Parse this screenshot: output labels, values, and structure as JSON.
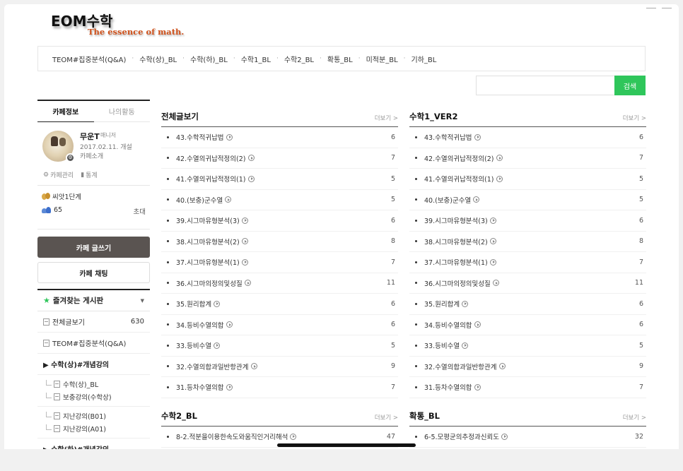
{
  "logo": {
    "main": "EOM수학",
    "tagline": "The essence of math."
  },
  "topnav": [
    "TEOM#집중분석(Q&A)",
    "수학(상)_BL",
    "수학(하)_BL",
    "수학1_BL",
    "수학2_BL",
    "확통_BL",
    "미적분_BL",
    "기하_BL"
  ],
  "search": {
    "button": "검색",
    "placeholder": ""
  },
  "sidebar": {
    "tabs": [
      "카페정보",
      "나의활동"
    ],
    "profile": {
      "name": "무운T",
      "role": "매니저",
      "date": "2017.02.11. 개설",
      "intro": "카페소개",
      "manage": "카페관리",
      "stats": "통계"
    },
    "level": "씨앗1단계",
    "members": "65",
    "invite": "초대",
    "write_button": "카페 글쓰기",
    "chat_button": "카페 채팅",
    "favorites": "즐겨찾는 게시판",
    "menu": {
      "all": "전체글보기",
      "all_count": "630",
      "teom": "TEOM#집중분석(Q&A)",
      "group1": "▶ 수학(상)#개념강의",
      "sub1": [
        "수학(상)_BL",
        "보충강의(수학상)"
      ],
      "sub2": [
        "지난강의(B01)",
        "지난강의(A01)"
      ],
      "group2": "▶ 수학(하)#개념강의"
    }
  },
  "more_label": "더보기 >",
  "boards": [
    {
      "title": "전체글보기",
      "posts": [
        {
          "t": "43.수학적귀납법",
          "c": "6"
        },
        {
          "t": "42.수열의귀납적정의(2)",
          "c": "7"
        },
        {
          "t": "41.수열의귀납적정의(1)",
          "c": "5"
        },
        {
          "t": "40.(보충)군수열",
          "c": "5"
        },
        {
          "t": "39.시그마유형분석(3)",
          "c": "6"
        },
        {
          "t": "38.시그마유형분석(2)",
          "c": "8"
        },
        {
          "t": "37.시그마유형분석(1)",
          "c": "7"
        },
        {
          "t": "36.시그마의정의및성질",
          "c": "11"
        },
        {
          "t": "35.원리합계",
          "c": "6"
        },
        {
          "t": "34.등비수열의합",
          "c": "6"
        },
        {
          "t": "33.등비수열",
          "c": "5"
        },
        {
          "t": "32.수열의합과일반항관계",
          "c": "9"
        },
        {
          "t": "31.등차수열의합",
          "c": "7"
        }
      ]
    },
    {
      "title": "수학1_VER2",
      "posts": [
        {
          "t": "43.수학적귀납법",
          "c": "6"
        },
        {
          "t": "42.수열의귀납적정의(2)",
          "c": "7"
        },
        {
          "t": "41.수열의귀납적정의(1)",
          "c": "5"
        },
        {
          "t": "40.(보충)군수열",
          "c": "5"
        },
        {
          "t": "39.시그마유형분석(3)",
          "c": "6"
        },
        {
          "t": "38.시그마유형분석(2)",
          "c": "8"
        },
        {
          "t": "37.시그마유형분석(1)",
          "c": "7"
        },
        {
          "t": "36.시그마의정의및성질",
          "c": "11"
        },
        {
          "t": "35.원리합계",
          "c": "6"
        },
        {
          "t": "34.등비수열의합",
          "c": "6"
        },
        {
          "t": "33.등비수열",
          "c": "5"
        },
        {
          "t": "32.수열의합과일반항관계",
          "c": "9"
        },
        {
          "t": "31.등차수열의합",
          "c": "7"
        }
      ]
    },
    {
      "title": "수학2_BL",
      "posts": [
        {
          "t": "8-2.적분을이용한속도와움직인거리해석",
          "c": "47"
        }
      ]
    },
    {
      "title": "확통_BL",
      "posts": [
        {
          "t": "6-5.모평균의추정과신뢰도",
          "c": "32"
        }
      ]
    }
  ]
}
